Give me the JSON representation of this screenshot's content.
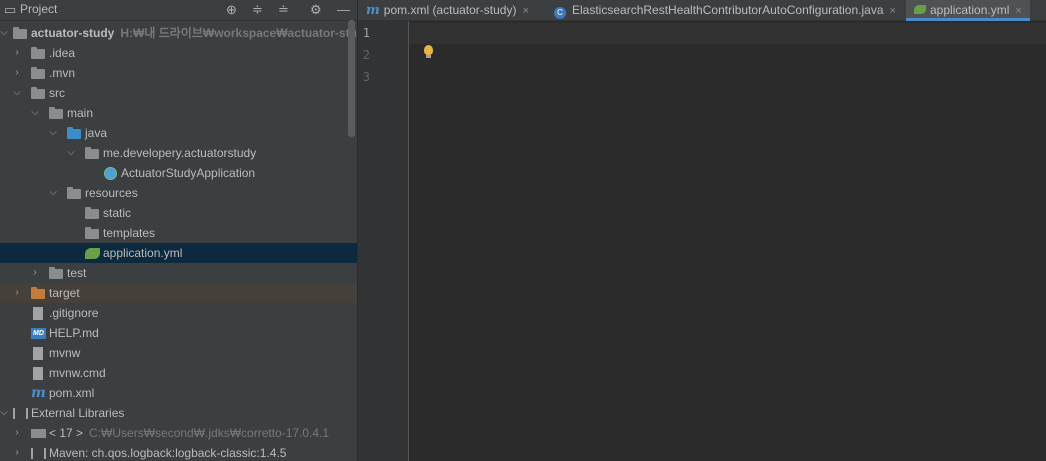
{
  "project_panel": {
    "title": "Project",
    "tree": [
      {
        "label": "actuator-study",
        "hint": "H:₩내 드라이브₩workspace₩actuator-study",
        "icon": "module-folder-icon",
        "expanded": true,
        "bold": true
      },
      {
        "label": ".idea",
        "icon": "folder-icon",
        "expanded": false
      },
      {
        "label": ".mvn",
        "icon": "folder-icon",
        "expanded": false
      },
      {
        "label": "src",
        "icon": "folder-icon",
        "expanded": true
      },
      {
        "label": "main",
        "icon": "folder-icon",
        "expanded": true
      },
      {
        "label": "java",
        "icon": "source-folder-icon",
        "expanded": true
      },
      {
        "label": "me.developery.actuatorstudy",
        "icon": "package-icon",
        "expanded": true
      },
      {
        "label": "ActuatorStudyApplication",
        "icon": "spring-class-icon"
      },
      {
        "label": "resources",
        "icon": "resources-folder-icon",
        "expanded": true
      },
      {
        "label": "static",
        "icon": "folder-icon"
      },
      {
        "label": "templates",
        "icon": "folder-icon"
      },
      {
        "label": "application.yml",
        "icon": "yaml-icon",
        "selected": true
      },
      {
        "label": "test",
        "icon": "folder-icon",
        "expanded": false
      },
      {
        "label": "target",
        "icon": "excluded-folder-icon",
        "expanded": false
      },
      {
        "label": ".gitignore",
        "icon": "gitignore-file-icon"
      },
      {
        "label": "HELP.md",
        "icon": "markdown-file-icon"
      },
      {
        "label": "mvnw",
        "icon": "script-file-icon"
      },
      {
        "label": "mvnw.cmd",
        "icon": "text-file-icon"
      },
      {
        "label": "pom.xml",
        "icon": "maven-icon"
      },
      {
        "label": "External Libraries",
        "icon": "libraries-icon",
        "expanded": true
      },
      {
        "label": "< 17 >",
        "hint": "C:₩Users₩second₩.jdks₩corretto-17.0.4.1",
        "icon": "jdk-icon",
        "expanded": false
      },
      {
        "label": "Maven: ch.qos.logback:logback-classic:1.4.5",
        "icon": "library-jar-icon",
        "expanded": false
      }
    ]
  },
  "tabs": [
    {
      "label": "pom.xml (actuator-study)",
      "icon": "maven-icon",
      "active": false
    },
    {
      "label": "ElasticsearchRestHealthContributorAutoConfiguration.java",
      "icon": "class-icon",
      "active": false
    },
    {
      "label": "application.yml",
      "icon": "yaml-icon",
      "active": true
    }
  ],
  "tab_close_glyph": "×",
  "editor": {
    "line_numbers": [
      "1",
      "2",
      "3"
    ],
    "current_line": "1"
  },
  "colors": {
    "selection": "#0d293e",
    "excluded": "#45403a",
    "accent": "#4a88c7"
  }
}
